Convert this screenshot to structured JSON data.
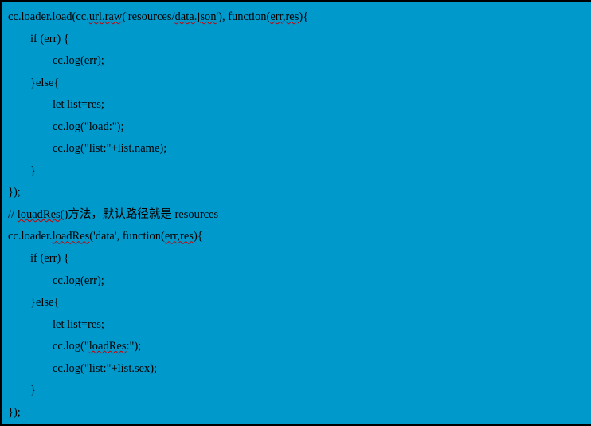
{
  "code": {
    "lines": [
      {
        "indent": 0,
        "segments": [
          {
            "t": "cc.loader.load(cc."
          },
          {
            "t": "url.raw",
            "squiggle": true
          },
          {
            "t": "('resources/"
          },
          {
            "t": "data.json",
            "squiggle": true
          },
          {
            "t": "'), function("
          },
          {
            "t": "err,res",
            "squiggle": true
          },
          {
            "t": "){"
          }
        ]
      },
      {
        "indent": 1,
        "segments": [
          {
            "t": "if (err) {"
          }
        ]
      },
      {
        "indent": 2,
        "segments": [
          {
            "t": "cc.log(err);"
          }
        ]
      },
      {
        "indent": 1,
        "segments": [
          {
            "t": "}else{"
          }
        ]
      },
      {
        "indent": 2,
        "segments": [
          {
            "t": "let list=res;"
          }
        ]
      },
      {
        "indent": 2,
        "segments": [
          {
            "t": "cc.log(\"load:\");"
          }
        ]
      },
      {
        "indent": 2,
        "segments": [
          {
            "t": "cc.log(\"list:\"+list.name);"
          }
        ]
      },
      {
        "indent": 1,
        "segments": [
          {
            "t": "}"
          }
        ]
      },
      {
        "indent": 0,
        "segments": [
          {
            "t": "});"
          }
        ]
      },
      {
        "indent": 0,
        "segments": [
          {
            "t": "// "
          },
          {
            "t": "louadRes",
            "squiggle": true
          },
          {
            "t": "()方法，默认路径就是 resources"
          }
        ]
      },
      {
        "indent": 0,
        "segments": [
          {
            "t": "cc.loader."
          },
          {
            "t": "loadRes",
            "squiggle": true
          },
          {
            "t": "('data', function("
          },
          {
            "t": "err,res",
            "squiggle": true
          },
          {
            "t": "){"
          }
        ]
      },
      {
        "indent": 1,
        "segments": [
          {
            "t": "if (err) {"
          }
        ]
      },
      {
        "indent": 2,
        "segments": [
          {
            "t": "cc.log(err);"
          }
        ]
      },
      {
        "indent": 1,
        "segments": [
          {
            "t": "}else{"
          }
        ]
      },
      {
        "indent": 2,
        "segments": [
          {
            "t": "let list=res;"
          }
        ]
      },
      {
        "indent": 2,
        "segments": [
          {
            "t": "cc.log(\""
          },
          {
            "t": "loadRes",
            "squiggle": true
          },
          {
            "t": ":\");"
          }
        ]
      },
      {
        "indent": 2,
        "segments": [
          {
            "t": "cc.log(\"list:\"+list.sex);"
          }
        ]
      },
      {
        "indent": 1,
        "segments": [
          {
            "t": "}"
          }
        ]
      },
      {
        "indent": 0,
        "segments": [
          {
            "t": "});"
          }
        ]
      }
    ]
  }
}
